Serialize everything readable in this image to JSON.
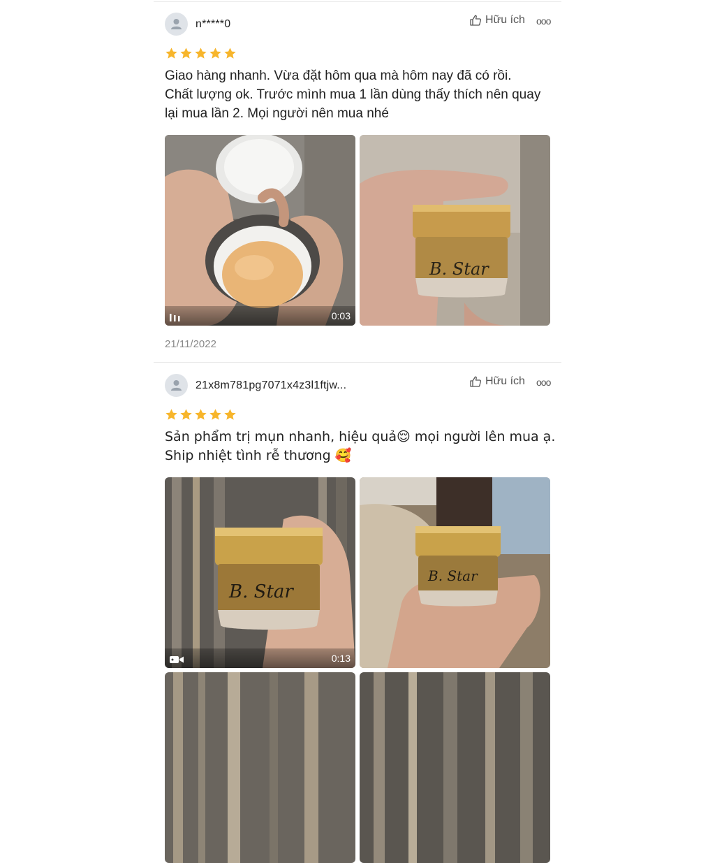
{
  "reviews": [
    {
      "username": "n*****0",
      "rating": 5,
      "helpful_label": "Hữu ích",
      "more_label": "ooo",
      "text_lines": [
        "Giao hàng nhanh. Vừa đặt hôm qua mà hôm nay đã có rồi.",
        "Chất lượng ok. Trước mình mua 1 lần dùng thấy thích nên quay",
        "lại mua lần 2. Mọi người nên mua nhé"
      ],
      "media": [
        {
          "type": "video",
          "duration": "0:03",
          "description": "opened jar with cream"
        },
        {
          "type": "image",
          "description": "gold jar B. Star"
        }
      ],
      "date": "21/11/2022"
    },
    {
      "username": "21x8m781pg7071x4z3l1ftjw...",
      "rating": 5,
      "helpful_label": "Hữu ích",
      "more_label": "ooo",
      "text_lines": [
        "Sản phẩm trị mụn nhanh, hiệu quả😌 mọi người lên mua ạ.",
        "Ship nhiệt tình rễ thương 🥰"
      ],
      "media": [
        {
          "type": "video",
          "duration": "0:13",
          "description": "gold jar B. Star"
        },
        {
          "type": "image",
          "description": "gold jar B. Star"
        }
      ]
    }
  ],
  "colors": {
    "star": "#f7b52b",
    "avatar_bg": "#dfe3e8",
    "jar_gold": "#c9a24a"
  },
  "icons": [
    "user-icon",
    "thumbs-up-icon",
    "more-icon",
    "star-icon",
    "video-playing-icon",
    "video-camera-icon"
  ]
}
